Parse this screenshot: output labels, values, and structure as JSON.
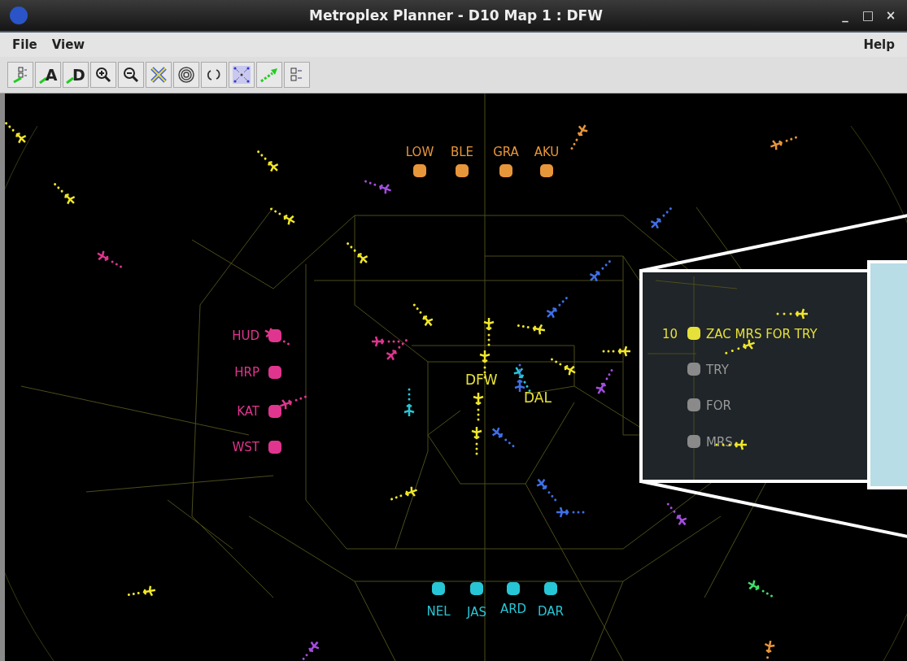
{
  "window": {
    "title": "Metroplex Planner - D10 Map 1 : DFW",
    "controls": [
      "_",
      "□",
      "×"
    ]
  },
  "menu": {
    "left": [
      "File",
      "View"
    ],
    "right": [
      "Help"
    ]
  },
  "toolbar": [
    {
      "kind": "filter"
    },
    {
      "kind": "arrival",
      "label": "A"
    },
    {
      "kind": "departure",
      "label": "D"
    },
    {
      "kind": "zoom-in"
    },
    {
      "kind": "zoom-out"
    },
    {
      "kind": "cross"
    },
    {
      "kind": "rings"
    },
    {
      "kind": "refresh"
    },
    {
      "kind": "fit"
    },
    {
      "kind": "route"
    },
    {
      "kind": "checklist"
    }
  ],
  "map": {
    "airports": [
      {
        "label": "DFW"
      },
      {
        "label": "DAL"
      }
    ],
    "fix_groups": [
      {
        "color": "#e8963a",
        "fixes": [
          "LOW",
          "BLE",
          "GRA",
          "AKU"
        ]
      },
      {
        "color": "#e0358f",
        "fixes": [
          "HUD",
          "HRP",
          "KAT",
          "WST"
        ]
      },
      {
        "color": "#27c6d6",
        "fixes": [
          "NEL",
          "JAS",
          "ARD",
          "DAR"
        ]
      }
    ],
    "inset": {
      "count": "10",
      "fixes": [
        {
          "label": "ZAC MRS FOR TRY",
          "active": true
        },
        {
          "label": "TRY",
          "active": false
        },
        {
          "label": "FOR",
          "active": false
        },
        {
          "label": "MRS",
          "active": false
        }
      ]
    }
  }
}
